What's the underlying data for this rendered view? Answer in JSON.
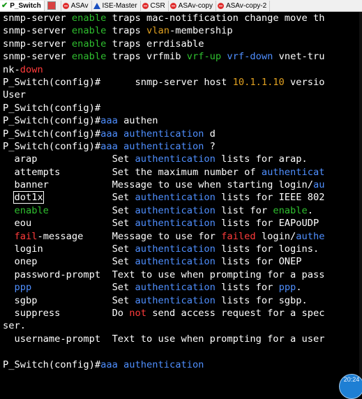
{
  "tabs": [
    {
      "label": "P_Switch",
      "icon": "check-icon",
      "active": true
    },
    {
      "label": "",
      "icon": "window-icon",
      "active": false
    },
    {
      "label": "ASAv",
      "icon": "stop-icon",
      "active": false
    },
    {
      "label": "ISE-Master",
      "icon": "warning-icon",
      "active": false
    },
    {
      "label": "CSR",
      "icon": "stop-icon",
      "active": false
    },
    {
      "label": "ASAv-copy",
      "icon": "stop-icon",
      "active": false
    },
    {
      "label": "ASAv-copy-2",
      "icon": "stop-icon",
      "active": false
    }
  ],
  "terminal_lines": [
    [
      [
        "w",
        "snmp-server "
      ],
      [
        "g",
        "enable"
      ],
      [
        "w",
        " traps mac-notification change move th"
      ]
    ],
    [
      [
        "w",
        "snmp-server "
      ],
      [
        "g",
        "enable"
      ],
      [
        "w",
        " traps "
      ],
      [
        "o",
        "vlan"
      ],
      [
        "w",
        "-membership"
      ]
    ],
    [
      [
        "w",
        "snmp-server "
      ],
      [
        "g",
        "enable"
      ],
      [
        "w",
        " traps errdisable"
      ]
    ],
    [
      [
        "w",
        "snmp-server "
      ],
      [
        "g",
        "enable"
      ],
      [
        "w",
        " traps vrfmib "
      ],
      [
        "g",
        "vrf-up"
      ],
      [
        "w",
        " "
      ],
      [
        "b",
        "vrf-down"
      ],
      [
        "w",
        " vnet-tru"
      ]
    ],
    [
      [
        "w",
        "nk-"
      ],
      [
        "r",
        "down"
      ]
    ],
    [
      [
        "w",
        "P_Switch(config)#      snmp-server host "
      ],
      [
        "o",
        "10.1.1.10"
      ],
      [
        "w",
        " versio"
      ]
    ],
    [
      [
        "w",
        "User"
      ]
    ],
    [
      [
        "w",
        "P_Switch(config)#"
      ]
    ],
    [
      [
        "w",
        "P_Switch(config)#"
      ],
      [
        "b",
        "aaa"
      ],
      [
        "w",
        " authen"
      ]
    ],
    [
      [
        "w",
        "P_Switch(config)#"
      ],
      [
        "b",
        "aaa authentication"
      ],
      [
        "w",
        " d"
      ]
    ],
    [
      [
        "w",
        "P_Switch(config)#"
      ],
      [
        "b",
        "aaa authentication"
      ],
      [
        "w",
        " ?"
      ]
    ],
    [
      [
        "w",
        "  arap             Set "
      ],
      [
        "b",
        "authentication"
      ],
      [
        "w",
        " lists for arap."
      ]
    ],
    [
      [
        "w",
        "  attempts         Set the maximum number of "
      ],
      [
        "b",
        "authenticat"
      ]
    ],
    [
      [
        "w",
        "  banner           Message to use when starting login/"
      ],
      [
        "b",
        "au"
      ]
    ],
    [
      [
        "hl",
        "dot1x"
      ],
      [
        "w",
        "            Set "
      ],
      [
        "b",
        "authentication"
      ],
      [
        "w",
        " lists for IEEE 802"
      ]
    ],
    [
      [
        "g",
        "  enable"
      ],
      [
        "w",
        "           Set "
      ],
      [
        "b",
        "authentication"
      ],
      [
        "w",
        " list for "
      ],
      [
        "g",
        "enable"
      ],
      [
        "w",
        "."
      ]
    ],
    [
      [
        "w",
        "  eou              Set "
      ],
      [
        "b",
        "authentication"
      ],
      [
        "w",
        " lists for EAPoUDP"
      ]
    ],
    [
      [
        "r",
        "  fail"
      ],
      [
        "w",
        "-message     Message to use for "
      ],
      [
        "r",
        "failed"
      ],
      [
        "w",
        " login/"
      ],
      [
        "b",
        "authe"
      ]
    ],
    [
      [
        "w",
        "  login            Set "
      ],
      [
        "b",
        "authentication"
      ],
      [
        "w",
        " lists for logins."
      ]
    ],
    [
      [
        "w",
        "  onep             Set "
      ],
      [
        "b",
        "authentication"
      ],
      [
        "w",
        " lists for ONEP"
      ]
    ],
    [
      [
        "w",
        "  password-prompt  Text to use when prompting for a pass"
      ]
    ],
    [
      [
        "b",
        "  ppp"
      ],
      [
        "w",
        "              Set "
      ],
      [
        "b",
        "authentication"
      ],
      [
        "w",
        " lists for "
      ],
      [
        "b",
        "ppp"
      ],
      [
        "w",
        "."
      ]
    ],
    [
      [
        "w",
        "  sgbp             Set "
      ],
      [
        "b",
        "authentication"
      ],
      [
        "w",
        " lists for sgbp."
      ]
    ],
    [
      [
        "w",
        "  suppress         Do "
      ],
      [
        "r",
        "not"
      ],
      [
        "w",
        " send access request for a spec"
      ]
    ],
    [
      [
        "w",
        "ser."
      ]
    ],
    [
      [
        "w",
        "  username-prompt  Text to use when prompting for a user"
      ]
    ],
    [
      [
        "w",
        ""
      ]
    ],
    [
      [
        "w",
        "P_Switch(config)#"
      ],
      [
        "b",
        "aaa authentication"
      ]
    ]
  ],
  "badge": {
    "label": "20:24"
  }
}
